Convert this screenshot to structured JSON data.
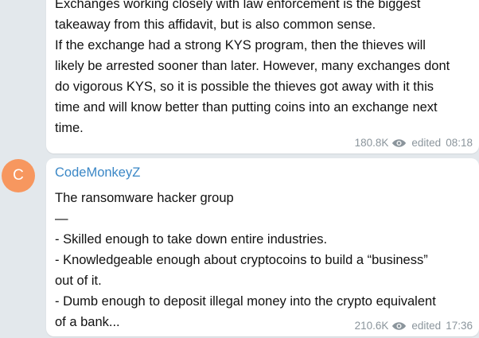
{
  "post1": {
    "lines": [
      "Exchanges working closely with law enforcement is the biggest",
      "takeaway from this affidavit, but is also common sense.",
      "If the exchange had a strong KYS program, then the thieves will",
      "likely be arrested sooner than later. However, many exchanges dont",
      "do vigorous KYS, so it is possible the thieves got away with it this",
      "time and will know better than putting coins into an exchange next",
      "time."
    ],
    "views": "180.8K",
    "edited_label": "edited",
    "time": "08:18"
  },
  "post2": {
    "avatar_letter": "C",
    "avatar_color": "#f7975f",
    "author": "CodeMonkeyZ",
    "author_color": "#3a87c6",
    "lines": [
      "The ransomware hacker group",
      "—",
      "- Skilled enough to take down entire industries.",
      "- Knowledgeable enough about cryptocoins to build a “business”",
      "out of it.",
      "- Dumb enough to deposit illegal money into the crypto equivalent",
      "of a bank..."
    ],
    "views": "210.6K",
    "edited_label": "edited",
    "time": "17:36"
  },
  "icons": {
    "views": "eye-icon"
  }
}
